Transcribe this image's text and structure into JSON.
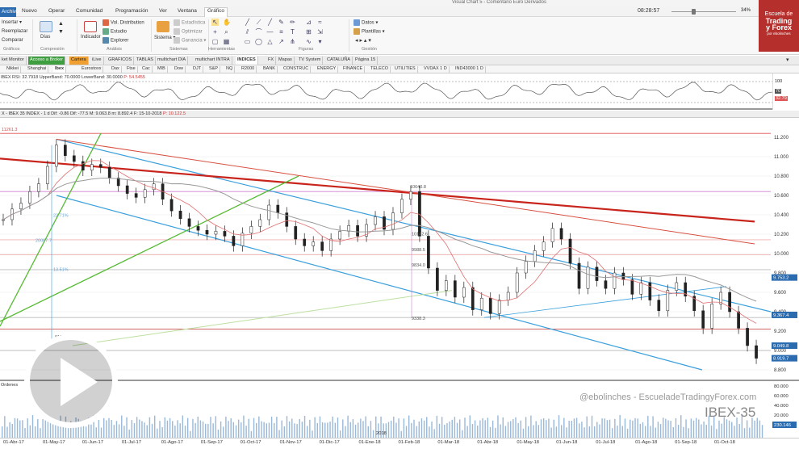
{
  "window": {
    "title": "Visual Chart 5 - Comentario Euro Derivados"
  },
  "menu": {
    "file_label": "Archivo",
    "items": [
      "Nuevo",
      "Operar",
      "Comunidad",
      "Programación",
      "Ver",
      "Ventana",
      "Gráfico"
    ],
    "active_item": "Gráfico"
  },
  "clock": "08:28:57",
  "zoom": "34%",
  "ribbon": {
    "graficos": {
      "items": [
        "Insertar",
        "Reemplazar",
        "Comparar"
      ],
      "group": "Gráficos"
    },
    "compresion": {
      "label": "Días",
      "group": "Compresión"
    },
    "analisis": {
      "indicator": "Indicador",
      "items": [
        "Vol. Distribution",
        "Estudio",
        "Explorer"
      ],
      "group": "Análisis"
    },
    "sistemas": {
      "system": "Sistema",
      "items": [
        "Estadística",
        "Optimizar",
        "Ganancia"
      ],
      "group": "Sistemas"
    },
    "herramientas": {
      "group": "Herramientas"
    },
    "figuras": {
      "group": "Figuras"
    },
    "gestion": {
      "items": [
        "Datos",
        "Plantillas"
      ],
      "group": "Gestión"
    }
  },
  "logo": {
    "lines": [
      "Escuela de",
      "Trading",
      "y Forex",
      "por ebolinches"
    ]
  },
  "tabs": [
    {
      "label": "ket Monitor",
      "style": ""
    },
    {
      "label": "Acceso a Broker",
      "style": "green"
    },
    {
      "label": "Cartera",
      "style": "orange"
    },
    {
      "label": "iLive",
      "style": ""
    },
    {
      "label": "GRAFICOS",
      "style": ""
    },
    {
      "label": "TABLAS",
      "style": ""
    },
    {
      "label": "multichart DIA",
      "style": ""
    },
    {
      "label": "multichart INTRA",
      "style": ""
    },
    {
      "label": "INDICES",
      "style": "active"
    },
    {
      "label": "FX",
      "style": ""
    },
    {
      "label": "Mapas",
      "style": ""
    },
    {
      "label": "TV System",
      "style": ""
    },
    {
      "label": "CATALUÑA",
      "style": ""
    },
    {
      "label": "Página 15",
      "style": ""
    }
  ],
  "symbols": [
    {
      "label": "Nikkei",
      "active": false
    },
    {
      "label": "Shanghai",
      "active": false
    },
    {
      "label": "Ibex",
      "active": true
    },
    {
      "label": "Eurostoxx",
      "active": false
    },
    {
      "label": "Dax",
      "active": false
    },
    {
      "label": "Ftse",
      "active": false
    },
    {
      "label": "Cac",
      "active": false
    },
    {
      "label": "MIB",
      "active": false
    },
    {
      "label": "Dow",
      "active": false
    },
    {
      "label": "DJT",
      "active": false
    },
    {
      "label": "S&P",
      "active": false
    },
    {
      "label": "NQ",
      "active": false
    },
    {
      "label": "R2000",
      "active": false
    },
    {
      "label": "BANK",
      "active": false
    },
    {
      "label": "CONSTRUC",
      "active": false
    },
    {
      "label": "ENERGY",
      "active": false
    },
    {
      "label": "FINANCE",
      "active": false
    },
    {
      "label": "TELECO",
      "active": false
    },
    {
      "label": "UTILITIES",
      "active": false
    },
    {
      "label": "VVDAX 1 D",
      "active": false
    },
    {
      "label": "IND43000 1 D",
      "active": false
    }
  ],
  "rsi": {
    "label": "IBEX RSI: 32.7918 UpperBand: 70.0000 LowerBand: 30.0000",
    "value_label": "P: 54.5455",
    "scale": [
      "100",
      "70",
      "32.79"
    ]
  },
  "chart_header": {
    "label": "X - IBEX 35 INDEX - 1 d  Dif: -0.86  Dif: -77.5  M: 9.063.8  m: 8.892.4  F: 15-10-2018",
    "price_label": "P: 10.122.5"
  },
  "chart_data": {
    "type": "line",
    "title": "IBEX 35",
    "y_ticks": [
      "11.200",
      "11.000",
      "10.800",
      "10.600",
      "10.400",
      "10.200",
      "10.000",
      "9.800",
      "9.600",
      "9.400",
      "9.200",
      "9.000",
      "8.800"
    ],
    "ylim": [
      8700,
      11400
    ],
    "x_ticks": [
      "01-Abr-17",
      "01-May-17",
      "01-Jun-17",
      "01-Jul-17",
      "01-Ago-17",
      "01-Sep-17",
      "01-Oct-17",
      "01-Nov-17",
      "01-Dic-17",
      "01-Ene-18",
      "01-Feb-18",
      "01-Mar-18",
      "01-Abr-18",
      "01-May-18",
      "01-Jun-18",
      "01-Jul-18",
      "01-Ago-18",
      "01-Sep-18",
      "01-Oct-18"
    ],
    "year_label": "2018",
    "series": [
      {
        "values": [
          10350,
          10460,
          10520,
          10640,
          10720,
          10900,
          11120,
          11010,
          10950,
          10860,
          10920,
          10890,
          10780,
          10700,
          10620,
          10580,
          10660,
          10720,
          10560,
          10440,
          10360,
          10280,
          10240,
          10200,
          10230,
          10180,
          10080,
          10210,
          10280,
          10350,
          10500,
          10420,
          10280,
          10150,
          10080,
          10120,
          10030,
          10150,
          10230,
          10290,
          10180,
          10300,
          10380,
          10250,
          10420,
          10560,
          10640,
          10180,
          9850,
          9620,
          9720,
          9550,
          9650,
          9420,
          9540,
          9380,
          9520,
          9600,
          9800,
          9920,
          10030,
          10120,
          10260,
          10150,
          9900,
          9640,
          9860,
          9720,
          9640,
          9800,
          9730,
          9580,
          9700,
          9520,
          9410,
          9620,
          9700,
          9560,
          9410,
          9230,
          9480,
          9600,
          9400,
          9230,
          9050,
          8920
        ]
      }
    ],
    "annotations": [
      "10640.8",
      "10142.6",
      "9988.5",
      "9834.0",
      "9338.3",
      "11261.3",
      "9114.7"
    ],
    "price_tags": [
      {
        "label": "9.753.2",
        "color": "#2b6cb0"
      },
      {
        "label": "9.367.4",
        "color": "#2b6cb0"
      },
      {
        "label": "9.049.8",
        "color": "#2b6cb0"
      },
      {
        "label": "8.919.7",
        "color": "#2b6cb0"
      }
    ],
    "left_labels": [
      "22.71%",
      "20087.7",
      "13.51%"
    ],
    "volume_scale": [
      "80.000",
      "60.000",
      "40.000",
      "20.000",
      "230.146"
    ],
    "volume_label": "Ordenes"
  },
  "watermark": "@ebolinches - EscueladeTradingyForex.com",
  "symbol_big": "IBEX-35"
}
